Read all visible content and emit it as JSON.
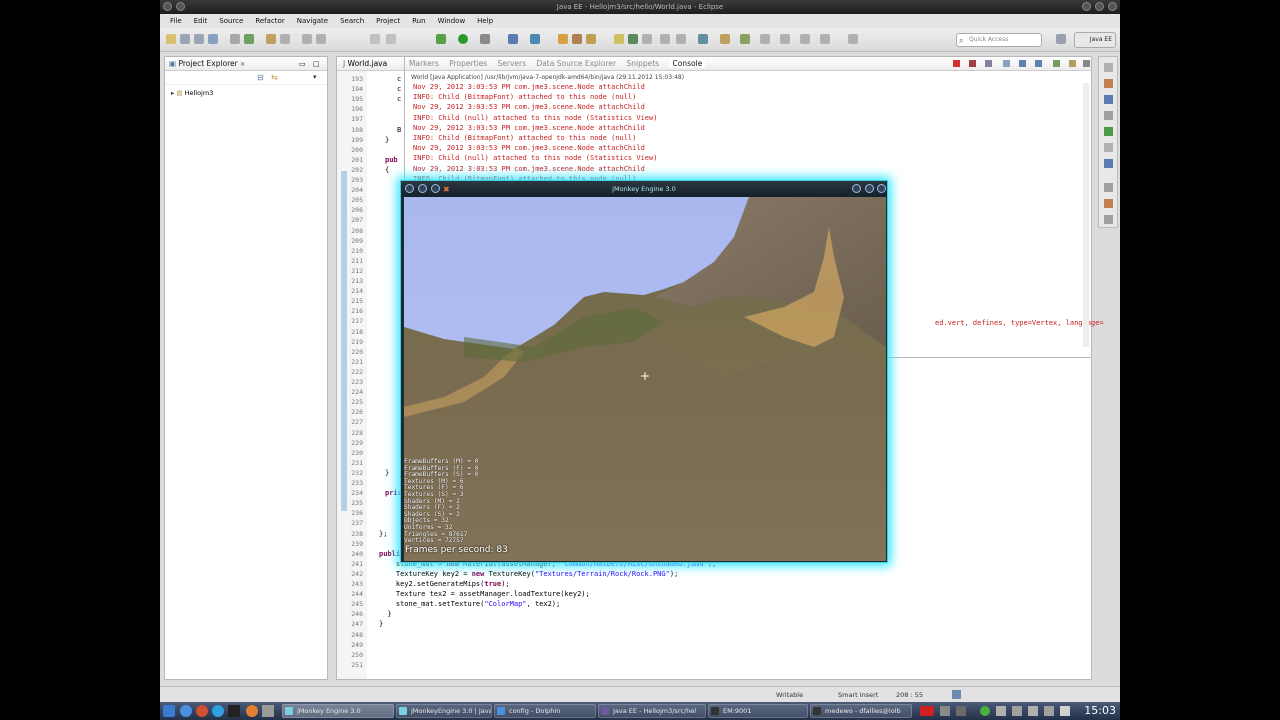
{
  "window": {
    "title": "Java EE - Hellojm3/src/hello/World.java - Eclipse"
  },
  "menu": [
    "File",
    "Edit",
    "Source",
    "Refactor",
    "Navigate",
    "Search",
    "Project",
    "Run",
    "Window",
    "Help"
  ],
  "toolbar": {
    "quick_access_placeholder": "Quick Access",
    "perspective": "Java EE"
  },
  "project_explorer": {
    "tab_label": "Project Explorer",
    "tree": [
      {
        "label": "Hellojm3"
      }
    ]
  },
  "editor": {
    "tab_label": "World.java",
    "line_numbers": [
      "193",
      "194",
      "195",
      "196",
      "197",
      "198",
      "199",
      "200",
      "201",
      "202",
      "203",
      "204",
      "205",
      "206",
      "207",
      "208",
      "209",
      "210",
      "211",
      "212",
      "213",
      "214",
      "215",
      "216",
      "217",
      "218",
      "219",
      "220",
      "221",
      "222",
      "223",
      "224",
      "225",
      "226",
      "227",
      "228",
      "229",
      "230",
      "231",
      "232",
      "233",
      "234",
      "235",
      "236",
      "237",
      "238",
      "239",
      "240",
      "241",
      "242",
      "243",
      "244",
      "245",
      "246",
      "247",
      "248",
      "249",
      "250",
      "251"
    ],
    "visible_code": [
      {
        "line": "c",
        "indent": 3
      },
      {
        "line": "c",
        "indent": 3
      },
      {
        "line": "c",
        "indent": 3
      },
      {
        "line": "",
        "indent": 0
      },
      {
        "line": "",
        "indent": 0
      },
      {
        "line": "B",
        "indent": 3
      },
      {
        "line": "}",
        "indent": 1
      },
      {
        "line": "",
        "indent": 0
      },
      {
        "line": "pub",
        "indent": 1
      },
      {
        "line": "{",
        "indent": 1
      }
    ],
    "lower_code": [
      {
        "line": "}",
        "indent": 1,
        "kind": "plain"
      },
      {
        "line": "priv",
        "indent": 1,
        "kind": "kw"
      },
      {
        "line": "};",
        "indent": 0,
        "kind": "plain"
      },
      {
        "line": "",
        "indent": 0,
        "kind": "plain"
      },
      {
        "line": "public void initMaterials() {",
        "indent": 0,
        "kind": "mixed-public"
      },
      {
        "line": "    stone_mat = new Material(assetManager, \"Common/MatDefs/Misc/Unshaded.j3md\");",
        "indent": 0,
        "kind": "mixed-new1"
      },
      {
        "line": "    TextureKey key2 = new TextureKey(\"Textures/Terrain/Rock/Rock.PNG\");",
        "indent": 0,
        "kind": "mixed-new2"
      },
      {
        "line": "    key2.setGenerateMips(true);",
        "indent": 0,
        "kind": "mixed-true"
      },
      {
        "line": "    Texture tex2 = assetManager.loadTexture(key2);",
        "indent": 0,
        "kind": "plain"
      },
      {
        "line": "    stone_mat.setTexture(\"ColorMap\", tex2);",
        "indent": 0,
        "kind": "mixed-str"
      },
      {
        "line": "  }",
        "indent": 0,
        "kind": "plain"
      },
      {
        "line": "}",
        "indent": 0,
        "kind": "plain"
      }
    ]
  },
  "console": {
    "tabs": [
      "Markers",
      "Properties",
      "Servers",
      "Data Source Explorer",
      "Snippets",
      "Console"
    ],
    "active_tab": "Console",
    "header": "World [Java Application] /usr/lib/jvm/java-7-openjdk-amd64/bin/java (29.11.2012 15:03:48)",
    "lines": [
      "Nov 29, 2012 3:03:53 PM com.jme3.scene.Node attachChild",
      "INFO: Child (BitmapFont) attached to this node (null)",
      "Nov 29, 2012 3:03:53 PM com.jme3.scene.Node attachChild",
      "INFO: Child (null) attached to this node (Statistics View)",
      "Nov 29, 2012 3:03:53 PM com.jme3.scene.Node attachChild",
      "INFO: Child (BitmapFont) attached to this node (null)",
      "Nov 29, 2012 3:03:53 PM com.jme3.scene.Node attachChild",
      "INFO: Child (null) attached to this node (Statistics View)",
      "Nov 29, 2012 3:03:53 PM com.jme3.scene.Node attachChild",
      "INFO: Child (BitmapFont) attached to this node (null)"
    ],
    "partial_right": "ed.vert, defines, type=Vertex, language="
  },
  "status_bar": {
    "writable": "Writable",
    "insert_mode": "Smart Insert",
    "position": "208 : 55"
  },
  "taskbar": {
    "apps": [
      "jMonkey Engine 3.0",
      "jMonkeyEngine 3.0 | Java",
      "config - Dolphin",
      "Java EE - Hellojm3/src/hel",
      "EM:9001",
      "medewo - dfallies@lolb"
    ],
    "clock": "15:03"
  },
  "jme": {
    "title": "jMonkey Engine 3.0",
    "stats": [
      "FrameBuffers (M) = 0",
      "FrameBuffers (F) = 0",
      "FrameBuffers (S) = 0",
      "Textures (M) = 6",
      "Textures (F) = 6",
      "Textures (S) = 3",
      "Shaders (M) = 2",
      "Shaders (F) = 2",
      "Shaders (S) = 2",
      "Objects = 32",
      "Uniforms = 32",
      "Triangles = 87617",
      "Vertices = 72757"
    ],
    "fps_label": "Frames per second: 83"
  }
}
